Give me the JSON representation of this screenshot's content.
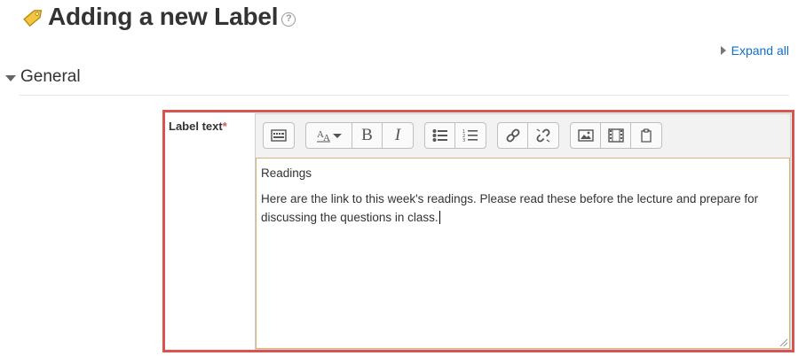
{
  "page": {
    "title": "Adding a new Label",
    "help_icon": "?"
  },
  "header": {
    "expand_all": "Expand all"
  },
  "section": {
    "title": "General"
  },
  "field": {
    "label": "Label text",
    "required_marker": "*"
  },
  "toolbar": {
    "groups": [
      [
        "toolbar-toggle-icon"
      ],
      [
        "font-size-icon",
        "bold-icon",
        "italic-icon"
      ],
      [
        "bullet-list-icon",
        "numbered-list-icon"
      ],
      [
        "link-icon",
        "unlink-icon"
      ],
      [
        "image-icon",
        "media-icon",
        "manage-files-icon"
      ]
    ],
    "bold": "B",
    "italic": "I"
  },
  "editor": {
    "heading": "Readings",
    "body": "Here are the link to this week's readings. Please read these before the lecture and prepare for discussing the questions in class."
  },
  "colors": {
    "link": "#0f6fc5",
    "highlight_border": "#d9534f",
    "required": "#d9534f",
    "editor_border": "#d9b47a"
  }
}
